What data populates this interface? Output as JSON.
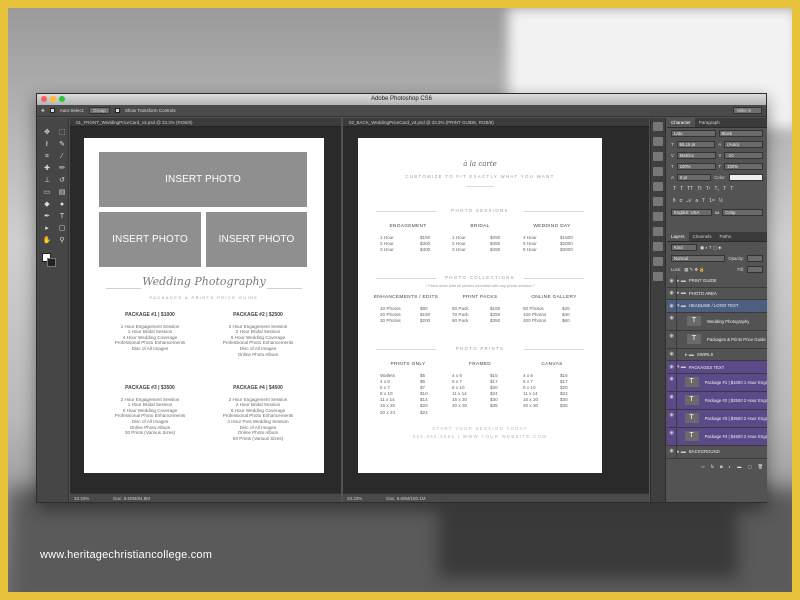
{
  "watermark": "www.heritagechristiancollege.com",
  "window": {
    "title": "Adobe Photoshop CS6"
  },
  "options_bar": {
    "auto_select": "Auto-Select:",
    "group": "Group",
    "show_transform": "Show Transform Controls",
    "workspace": "Mike S"
  },
  "front_doc": {
    "tab": "01_FRONT_WeddingPriceCard_v3.psd @ 33.3% (RGB/8)",
    "zoom": "33.33%",
    "doc_size": "Doc: 8.60M/84.8M",
    "photo_placeholders": [
      "INSERT PHOTO",
      "INSERT PHOTO",
      "INSERT PHOTO"
    ],
    "script_title": "Wedding Photography",
    "subtitle": "PACKAGES & PRINTS PRICE GUIDE",
    "packages": [
      {
        "title": "PACKAGE #1 | $1000",
        "lines": [
          "1 Hour Engagement Session",
          "1 Hour Bridal Session",
          "4 Hour Wedding Coverage",
          "Professional Photo Enhancements",
          "Disc of All Images"
        ]
      },
      {
        "title": "PACKAGE #2 | $2500",
        "lines": [
          "2 Hour Engagement Session",
          "2 Hour Bridal Session",
          "6 Hour Wedding Coverage",
          "Professional Photo Enhancements",
          "Disc of All Images",
          "Online Photo Album"
        ]
      },
      {
        "title": "PACKAGE #3 | $3500",
        "lines": [
          "2 Hour Engagement Session",
          "1 Hour Bridal Session",
          "6 Hour Wedding Coverage",
          "Professional Photo Enhancements",
          "Disc of All Images",
          "Online Photo Album",
          "30 Prints (Various Sizes)"
        ]
      },
      {
        "title": "PACKAGE #4 | $4500",
        "lines": [
          "2 Hour Engagement Session",
          "2 Hour Bridal Session",
          "8 Hour Wedding Coverage",
          "Professional Photo Enhancements",
          "4 Hour Post Wedding Session",
          "Disc of All Images",
          "Online Photo Album",
          "50 Prints (Various Sizes)"
        ]
      }
    ]
  },
  "back_doc": {
    "tab": "02_BACK_WeddingPriceCard_v3.psd @ 33.3% (PRINT GUIDE, RGB/8)",
    "zoom": "33.33%",
    "doc_size": "Doc: 9.00M/150.1M",
    "heading": "à la carte",
    "subheading": "CUSTOMIZE TO FIT EXACTLY WHAT YOU WANT",
    "sessions": {
      "title": "PHOTO SESSIONS",
      "columns": [
        {
          "head": "ENGAGEMENT",
          "rows": [
            [
              "1 Hour",
              "$150"
            ],
            [
              "2 Hour",
              "$300"
            ],
            [
              "3 Hour",
              "$400"
            ]
          ]
        },
        {
          "head": "BRIDAL",
          "rows": [
            [
              "1 Hour",
              "$250"
            ],
            [
              "2 Hour",
              "$350"
            ],
            [
              "3 Hour",
              "$450"
            ]
          ]
        },
        {
          "head": "WEDDING DAY",
          "rows": [
            [
              "4 Hour",
              "$1500"
            ],
            [
              "6 Hour",
              "$2000"
            ],
            [
              "8 Hour",
              "$3000"
            ]
          ]
        }
      ]
    },
    "collections": {
      "title": "PHOTO COLLECTIONS",
      "note": "* Flash drive with all photos included with any photo session *",
      "columns": [
        {
          "head": "ENHANCEMENTS / EDITS",
          "rows": [
            [
              "10 Photos",
              "$80"
            ],
            [
              "20 Photos",
              "$150"
            ],
            [
              "30 Photos",
              "$200"
            ]
          ]
        },
        {
          "head": "PRINT PACKS",
          "rows": [
            [
              "50 Pack",
              "$150"
            ],
            [
              "70 Pack",
              "$250"
            ],
            [
              "90 Pack",
              "$350"
            ]
          ]
        },
        {
          "head": "ONLINE GALLERY",
          "rows": [
            [
              "50 Photos",
              "$25"
            ],
            [
              "100 Photos",
              "$40"
            ],
            [
              "200 Photos",
              "$60"
            ]
          ]
        }
      ]
    },
    "prints": {
      "title": "PHOTO PRINTS",
      "columns": [
        {
          "head": "PRINTS ONLY",
          "rows": [
            [
              "Wallets",
              "$5"
            ],
            [
              "4 x 6",
              "$5"
            ],
            [
              "5 x 7",
              "$7"
            ],
            [
              "8 x 10",
              "$10"
            ],
            [
              "11 x 14",
              "$14"
            ],
            [
              "16 x 20",
              "$20"
            ],
            [
              "20 x 24",
              "$24"
            ]
          ]
        },
        {
          "head": "FRAMED",
          "rows": [
            [
              "4 x 6",
              "$15"
            ],
            [
              "5 x 7",
              "$17"
            ],
            [
              "8 x 10",
              "$20"
            ],
            [
              "11 x 14",
              "$24"
            ],
            [
              "16 x 20",
              "$30"
            ],
            [
              "20 x 30",
              "$35"
            ]
          ]
        },
        {
          "head": "CANVAS",
          "rows": [
            [
              "4 x 6",
              "$15"
            ],
            [
              "5 x 7",
              "$17"
            ],
            [
              "8 x 10",
              "$20"
            ],
            [
              "11 x 14",
              "$24"
            ],
            [
              "16 x 20",
              "$30"
            ],
            [
              "20 x 30",
              "$35"
            ]
          ]
        }
      ]
    },
    "footer1": "START YOUR SESSION TODAY",
    "footer2": "555.555.5555 | WWW.YOUR WEBSITE.COM"
  },
  "character_panel": {
    "tabs": [
      "Character",
      "Paragraph"
    ],
    "font": "Lato",
    "style": "Black",
    "size": "65.15 pt",
    "leading": "(Auto)",
    "kerning": "Metrics",
    "tracking": "-10",
    "vscale": "100%",
    "hscale": "100%",
    "baseline": "0 pt",
    "color_label": "Color:",
    "language": "English: USA",
    "aa": "Crisp"
  },
  "layers_panel": {
    "tabs": [
      "Layers",
      "Channels",
      "Paths"
    ],
    "kind": "Kind",
    "blend": "Normal",
    "opacity_label": "Opacity:",
    "lock_label": "Lock:",
    "fill_label": "Fill:",
    "layers": [
      {
        "name": "PRINT GUIDE",
        "type": "group"
      },
      {
        "name": "PHOTO AREA",
        "type": "group"
      },
      {
        "name": "HEADLINE / LOGO TEXT",
        "type": "group"
      },
      {
        "name": "Wedding Photography",
        "type": "text"
      },
      {
        "name": "Packages & Prints Price Guide",
        "type": "text"
      },
      {
        "name": "SWIRLS",
        "type": "group"
      },
      {
        "name": "PACKAGES TEXT",
        "type": "group"
      },
      {
        "name": "Package #1 | $1000 1 Hour Engagement ...",
        "type": "text"
      },
      {
        "name": "Package #2 | $2500 2 Hour Engagement ...",
        "type": "text"
      },
      {
        "name": "Package #3 | $3500 2 Hour Engagement ...",
        "type": "text"
      },
      {
        "name": "Package #4 | $4500 2 Hour Engagement ...",
        "type": "text"
      },
      {
        "name": "BACKGROUND",
        "type": "group"
      }
    ]
  }
}
